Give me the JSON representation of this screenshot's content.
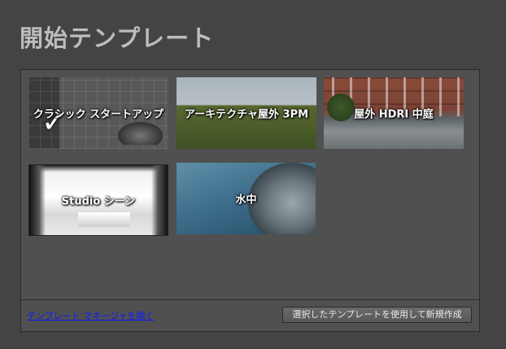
{
  "title": "開始テンプレート",
  "templates": [
    {
      "label": "クラシック スタートアップ",
      "selected": true
    },
    {
      "label": "アーキテクチャ屋外 3PM",
      "selected": false
    },
    {
      "label": "屋外 HDRI 中庭",
      "selected": false
    },
    {
      "label": "Studio シーン",
      "selected": false
    },
    {
      "label": "水中",
      "selected": false
    }
  ],
  "footer": {
    "manager_link": "テンプレート マネージャを開く",
    "create_button": "選択したテンプレートを使用して新規作成"
  }
}
